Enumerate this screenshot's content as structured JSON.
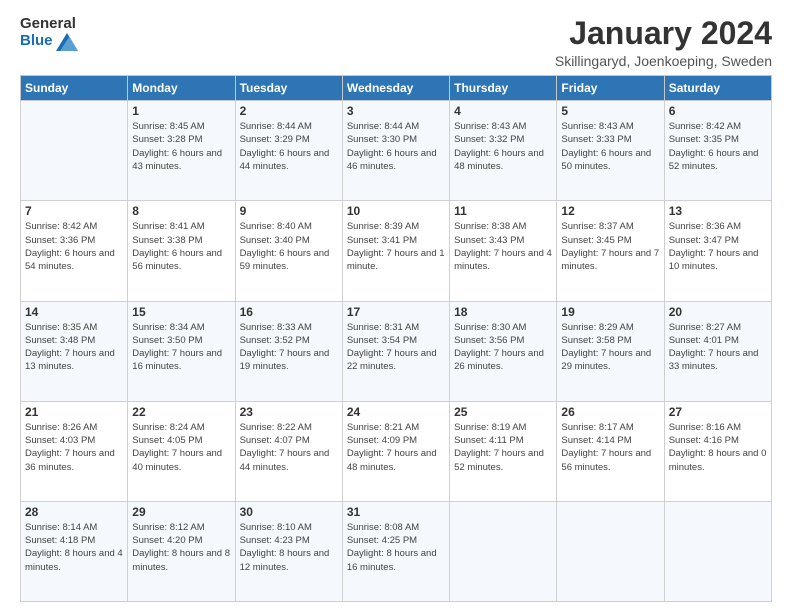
{
  "logo": {
    "general": "General",
    "blue": "Blue"
  },
  "header": {
    "title": "January 2024",
    "location": "Skillingaryd, Joenkoeping, Sweden"
  },
  "weekdays": [
    "Sunday",
    "Monday",
    "Tuesday",
    "Wednesday",
    "Thursday",
    "Friday",
    "Saturday"
  ],
  "weeks": [
    [
      {
        "day": null,
        "info": null
      },
      {
        "day": "1",
        "sunrise": "Sunrise: 8:45 AM",
        "sunset": "Sunset: 3:28 PM",
        "daylight": "Daylight: 6 hours and 43 minutes."
      },
      {
        "day": "2",
        "sunrise": "Sunrise: 8:44 AM",
        "sunset": "Sunset: 3:29 PM",
        "daylight": "Daylight: 6 hours and 44 minutes."
      },
      {
        "day": "3",
        "sunrise": "Sunrise: 8:44 AM",
        "sunset": "Sunset: 3:30 PM",
        "daylight": "Daylight: 6 hours and 46 minutes."
      },
      {
        "day": "4",
        "sunrise": "Sunrise: 8:43 AM",
        "sunset": "Sunset: 3:32 PM",
        "daylight": "Daylight: 6 hours and 48 minutes."
      },
      {
        "day": "5",
        "sunrise": "Sunrise: 8:43 AM",
        "sunset": "Sunset: 3:33 PM",
        "daylight": "Daylight: 6 hours and 50 minutes."
      },
      {
        "day": "6",
        "sunrise": "Sunrise: 8:42 AM",
        "sunset": "Sunset: 3:35 PM",
        "daylight": "Daylight: 6 hours and 52 minutes."
      }
    ],
    [
      {
        "day": "7",
        "sunrise": "Sunrise: 8:42 AM",
        "sunset": "Sunset: 3:36 PM",
        "daylight": "Daylight: 6 hours and 54 minutes."
      },
      {
        "day": "8",
        "sunrise": "Sunrise: 8:41 AM",
        "sunset": "Sunset: 3:38 PM",
        "daylight": "Daylight: 6 hours and 56 minutes."
      },
      {
        "day": "9",
        "sunrise": "Sunrise: 8:40 AM",
        "sunset": "Sunset: 3:40 PM",
        "daylight": "Daylight: 6 hours and 59 minutes."
      },
      {
        "day": "10",
        "sunrise": "Sunrise: 8:39 AM",
        "sunset": "Sunset: 3:41 PM",
        "daylight": "Daylight: 7 hours and 1 minute."
      },
      {
        "day": "11",
        "sunrise": "Sunrise: 8:38 AM",
        "sunset": "Sunset: 3:43 PM",
        "daylight": "Daylight: 7 hours and 4 minutes."
      },
      {
        "day": "12",
        "sunrise": "Sunrise: 8:37 AM",
        "sunset": "Sunset: 3:45 PM",
        "daylight": "Daylight: 7 hours and 7 minutes."
      },
      {
        "day": "13",
        "sunrise": "Sunrise: 8:36 AM",
        "sunset": "Sunset: 3:47 PM",
        "daylight": "Daylight: 7 hours and 10 minutes."
      }
    ],
    [
      {
        "day": "14",
        "sunrise": "Sunrise: 8:35 AM",
        "sunset": "Sunset: 3:48 PM",
        "daylight": "Daylight: 7 hours and 13 minutes."
      },
      {
        "day": "15",
        "sunrise": "Sunrise: 8:34 AM",
        "sunset": "Sunset: 3:50 PM",
        "daylight": "Daylight: 7 hours and 16 minutes."
      },
      {
        "day": "16",
        "sunrise": "Sunrise: 8:33 AM",
        "sunset": "Sunset: 3:52 PM",
        "daylight": "Daylight: 7 hours and 19 minutes."
      },
      {
        "day": "17",
        "sunrise": "Sunrise: 8:31 AM",
        "sunset": "Sunset: 3:54 PM",
        "daylight": "Daylight: 7 hours and 22 minutes."
      },
      {
        "day": "18",
        "sunrise": "Sunrise: 8:30 AM",
        "sunset": "Sunset: 3:56 PM",
        "daylight": "Daylight: 7 hours and 26 minutes."
      },
      {
        "day": "19",
        "sunrise": "Sunrise: 8:29 AM",
        "sunset": "Sunset: 3:58 PM",
        "daylight": "Daylight: 7 hours and 29 minutes."
      },
      {
        "day": "20",
        "sunrise": "Sunrise: 8:27 AM",
        "sunset": "Sunset: 4:01 PM",
        "daylight": "Daylight: 7 hours and 33 minutes."
      }
    ],
    [
      {
        "day": "21",
        "sunrise": "Sunrise: 8:26 AM",
        "sunset": "Sunset: 4:03 PM",
        "daylight": "Daylight: 7 hours and 36 minutes."
      },
      {
        "day": "22",
        "sunrise": "Sunrise: 8:24 AM",
        "sunset": "Sunset: 4:05 PM",
        "daylight": "Daylight: 7 hours and 40 minutes."
      },
      {
        "day": "23",
        "sunrise": "Sunrise: 8:22 AM",
        "sunset": "Sunset: 4:07 PM",
        "daylight": "Daylight: 7 hours and 44 minutes."
      },
      {
        "day": "24",
        "sunrise": "Sunrise: 8:21 AM",
        "sunset": "Sunset: 4:09 PM",
        "daylight": "Daylight: 7 hours and 48 minutes."
      },
      {
        "day": "25",
        "sunrise": "Sunrise: 8:19 AM",
        "sunset": "Sunset: 4:11 PM",
        "daylight": "Daylight: 7 hours and 52 minutes."
      },
      {
        "day": "26",
        "sunrise": "Sunrise: 8:17 AM",
        "sunset": "Sunset: 4:14 PM",
        "daylight": "Daylight: 7 hours and 56 minutes."
      },
      {
        "day": "27",
        "sunrise": "Sunrise: 8:16 AM",
        "sunset": "Sunset: 4:16 PM",
        "daylight": "Daylight: 8 hours and 0 minutes."
      }
    ],
    [
      {
        "day": "28",
        "sunrise": "Sunrise: 8:14 AM",
        "sunset": "Sunset: 4:18 PM",
        "daylight": "Daylight: 8 hours and 4 minutes."
      },
      {
        "day": "29",
        "sunrise": "Sunrise: 8:12 AM",
        "sunset": "Sunset: 4:20 PM",
        "daylight": "Daylight: 8 hours and 8 minutes."
      },
      {
        "day": "30",
        "sunrise": "Sunrise: 8:10 AM",
        "sunset": "Sunset: 4:23 PM",
        "daylight": "Daylight: 8 hours and 12 minutes."
      },
      {
        "day": "31",
        "sunrise": "Sunrise: 8:08 AM",
        "sunset": "Sunset: 4:25 PM",
        "daylight": "Daylight: 8 hours and 16 minutes."
      },
      {
        "day": null,
        "info": null
      },
      {
        "day": null,
        "info": null
      },
      {
        "day": null,
        "info": null
      }
    ]
  ]
}
